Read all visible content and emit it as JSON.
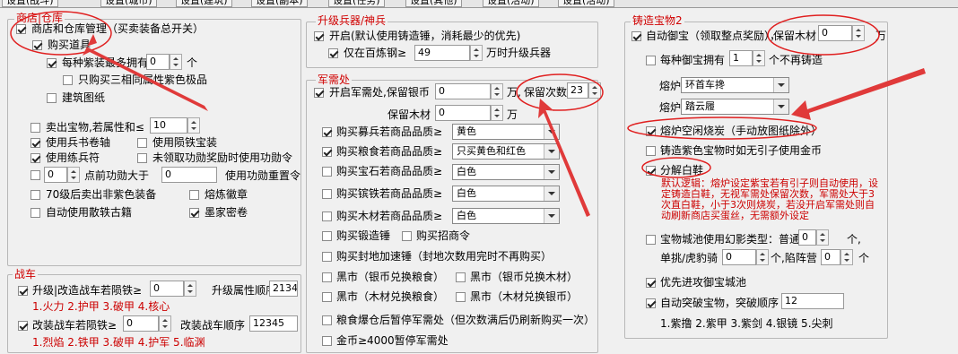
{
  "tabs": [
    "设置(战斗)",
    "设置(城市)",
    "设置(建筑)",
    "设置(副本)",
    "设置(任务)",
    "设置(其他)",
    "设置(活动)",
    "设置(活动)"
  ],
  "shop": {
    "title": "商店|仓库",
    "master": "商店和仓库管理（买卖装备总开关）",
    "buy_items": "购买道具",
    "each_purple_pre": "每种紫装最多拥有",
    "each_purple_val": "0",
    "each_purple_unit": "个",
    "only_three": "只购买三相同属性紫色极品",
    "blueprint": "建筑图纸",
    "sell_treasure": "卖出宝物,若属性和≤",
    "sell_val": "10",
    "use_scroll": "使用兵书卷轴",
    "use_jade": "使用陨铁宝装",
    "use_training": "使用练兵符",
    "unclaimed_merit": "未领取功勋奖励时使用功勋令",
    "points_val": "0",
    "points_mid": "点前功勋大于",
    "points_val2": "0",
    "use_merit_reset": "使用功勋重置令",
    "sell_70": "70级后卖出非紫色装备",
    "melt_badge": "熔炼徽章",
    "auto_book": "自动使用散轶古籍",
    "ink_key": "墨家密卷"
  },
  "weapon": {
    "title": "升级兵器/神兵",
    "enable": "开启(默认使用铸造锤，消耗最少的优先)",
    "only_steel": "仅在百炼钢≥",
    "steel_val": "49",
    "steel_unit": "万时升级兵器"
  },
  "army": {
    "title": "军需处",
    "enable": "开启军需处,保留银币",
    "silver_val": "0",
    "silver_unit": "万,",
    "keep_count_label": "保留次数",
    "keep_count_val": "23",
    "keep_wood_label": "保留木材",
    "wood_val": "0",
    "wood_unit": "万",
    "rows": [
      {
        "label": "购买募兵若商品品质≥",
        "value": "黄色",
        "checked": true
      },
      {
        "label": "购买粮食若商品品质≥",
        "value": "只买黄色和红色",
        "checked": true
      },
      {
        "label": "购买宝石若商品品质≥",
        "value": "白色",
        "checked": false
      },
      {
        "label": "购买镔铁若商品品质≥",
        "value": "白色",
        "checked": false
      },
      {
        "label": "购买木材若商品品质≥",
        "value": "白色",
        "checked": false
      }
    ],
    "buy_hammer": "购买锻造锤",
    "buy_recruit": "购买招商令",
    "buy_seal": "购买封地加速锤（封地次数用完时不再购买）",
    "black1": "黑市（银币兑换粮食）",
    "black2": "黑市（银币兑换木材）",
    "black3": "黑市（木材兑换粮食）",
    "black4": "黑市（木材兑换银币）",
    "grain_stop": "粮食爆仓后暂停军需处（但次数满后仍刷新购买一次）",
    "gold_stop": "金币≥4000暂停军需处"
  },
  "war": {
    "title": "战车",
    "upgrade": "升级|改造战车若陨铁≥",
    "upgrade_val": "0",
    "order_label": "升级属性顺序",
    "order_val": "2134",
    "hint1": "1.火力 2.护甲 3.破甲 4.核心",
    "modify": "改装战车若陨铁≥",
    "modify_val": "0",
    "modify_order_label": "改装战车顺序",
    "modify_order_val": "12345",
    "hint2": "1.烈焰 2.铁甲 3.破甲 4.护军 5.临渊"
  },
  "forge": {
    "title": "铸造宝物2",
    "auto": "自动御宝（领取整点奖励），",
    "keep_wood_label": "保留木材",
    "keep_wood_val": "0",
    "keep_wood_unit": "万",
    "each_pre": "每种御宝拥有",
    "each_val": "1",
    "each_post": "个不再铸造",
    "furnace1_label": "熔炉1",
    "furnace1_val": "环首车搀",
    "furnace2_label": "熔炉2",
    "furnace2_val": "踏云履",
    "idle_burn": "熔炉空闲烧炭（手动放图纸除外）",
    "purple_gold": "铸造紫色宝物时如无引子使用金币",
    "decompose": "分解白鞋",
    "note": "默认逻辑：熔炉设定紫宝若有引子则自动使用，设定铸造白鞋，无视军需处保留次数，军需处大于3次直白鞋，小于3次则烧炭，若没开启军需处则自动刷新商店买蛋丝，无需额外设定",
    "city_pre": "宝物城池使用幻影类型：普通",
    "city_val1": "0",
    "city_unit": "个,",
    "single_label": "单挑/虎豹骑",
    "single_val": "0",
    "single_mid": "个,陷阵营",
    "trap_val": "0",
    "trap_unit": "个",
    "prefer_city": "优先进攻御宝城池",
    "auto_break": "自动突破宝物，突破顺序",
    "break_val": "12",
    "hint": "1.紫撸 2.紫甲 3.紫剑 4.银镜 5.尖刺"
  }
}
